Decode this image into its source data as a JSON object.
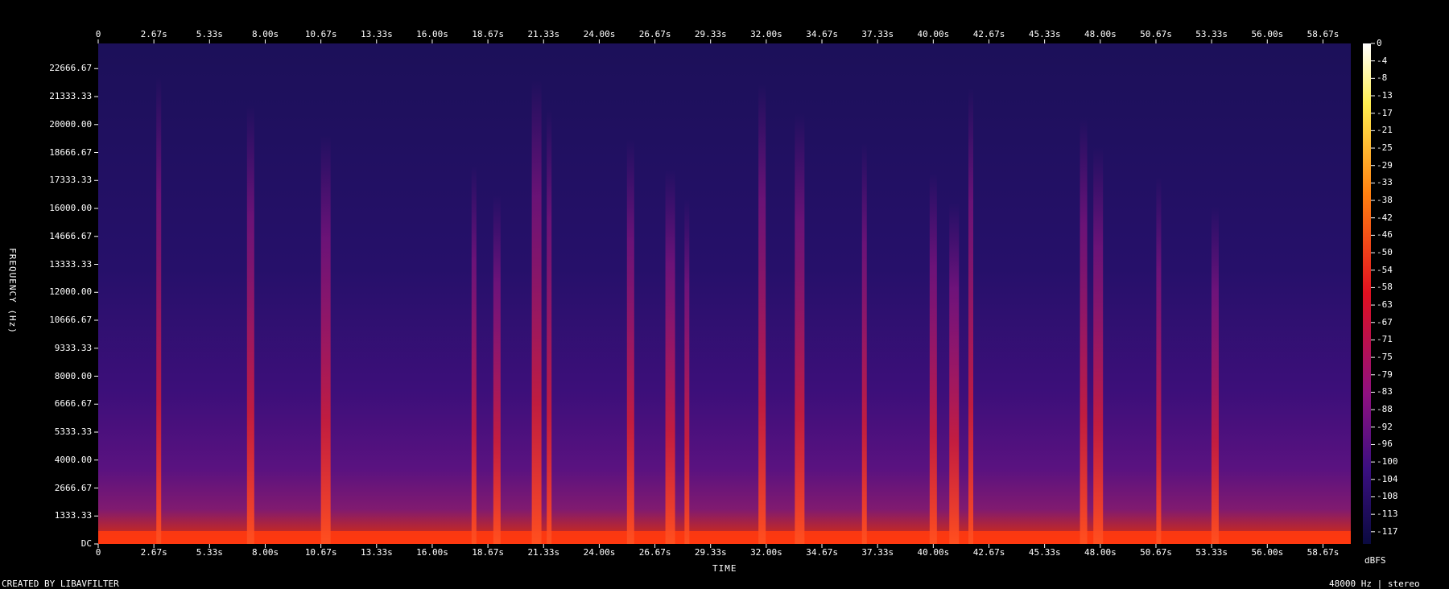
{
  "chart_data": {
    "type": "heatmap",
    "title": "",
    "xlabel": "TIME",
    "ylabel": "FREQUENCY (Hz)",
    "x_ticks": [
      "0",
      "2.67s",
      "5.33s",
      "8.00s",
      "10.67s",
      "13.33s",
      "16.00s",
      "18.67s",
      "21.33s",
      "24.00s",
      "26.67s",
      "29.33s",
      "32.00s",
      "34.67s",
      "37.33s",
      "40.00s",
      "42.67s",
      "45.33s",
      "48.00s",
      "50.67s",
      "53.33s",
      "56.00s",
      "58.67s"
    ],
    "y_ticks": [
      "DC",
      "1333.33",
      "2666.67",
      "4000.00",
      "5333.33",
      "6666.67",
      "8000.00",
      "9333.33",
      "10666.67",
      "12000.00",
      "13333.33",
      "14666.67",
      "16000.00",
      "17333.33",
      "18666.67",
      "20000.00",
      "21333.33",
      "22666.67"
    ],
    "xlim": [
      0,
      60
    ],
    "ylim": [
      0,
      24000
    ],
    "colorbar": {
      "unit_top": "dBFS",
      "unit_bottom": "dBFS",
      "ticks": [
        "0",
        "-4",
        "-8",
        "-13",
        "-17",
        "-21",
        "-25",
        "-29",
        "-33",
        "-38",
        "-42",
        "-46",
        "-50",
        "-54",
        "-58",
        "-63",
        "-67",
        "-71",
        "-75",
        "-79",
        "-83",
        "-88",
        "-92",
        "-96",
        "-100",
        "-104",
        "-108",
        "-113",
        "-117"
      ],
      "range": [
        -120,
        0
      ]
    },
    "bursts_s": [
      2.9,
      7.3,
      10.9,
      18.0,
      19.1,
      21.0,
      21.6,
      25.5,
      27.4,
      28.2,
      31.8,
      33.6,
      36.7,
      40.0,
      41.0,
      41.8,
      47.2,
      47.9,
      50.8,
      53.5
    ],
    "footer_left": "CREATED BY LIBAVFILTER",
    "footer_right": "48000 Hz | stereo",
    "colors": {
      "background": "#000000",
      "low": "#1e1060",
      "high": "#ffffff"
    }
  }
}
